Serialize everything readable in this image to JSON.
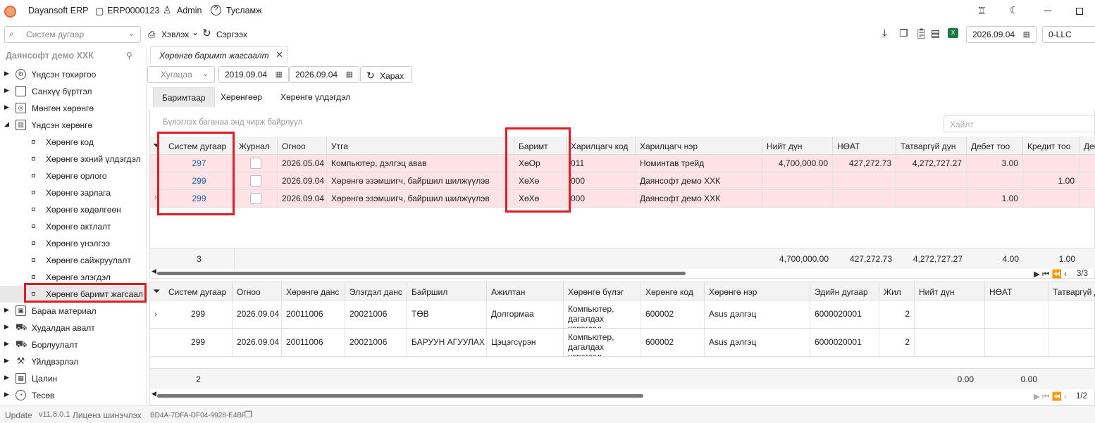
{
  "titlebar": {
    "app_name": "Dayansoft ERP",
    "doc_id": "ERP0000123",
    "user": "Admin",
    "help": "Тусламж"
  },
  "toolbar": {
    "system_number_placeholder": "Систем дугаар",
    "print_label": "Хэвлэх",
    "refresh_label": "Сэргээх",
    "date": "2026.09.04",
    "company_code": "0-LLC"
  },
  "sidebar": {
    "company": "Даянсофт демо ХХК",
    "items": [
      {
        "label": "Үндсэн тохиргоо",
        "icon": "gear-icon"
      },
      {
        "label": "Санхүү бүртгэл",
        "icon": "ledger-icon"
      },
      {
        "label": "Мөнгөн хөрөнгө",
        "icon": "money-icon"
      },
      {
        "label": "Үндсэн хөрөнгө",
        "icon": "building-icon"
      }
    ],
    "subitems": [
      "Хөрөнгө код",
      "Хөрөнгө эхний үлдэгдэл",
      "Хөрөнгө орлого",
      "Хөрөнгө зарлага",
      "Хөрөнгө хөдөлгөөн",
      "Хөрөнгө актлалт",
      "Хөрөнгө үнэлгээ",
      "Хөрөнгө сайжруулалт",
      "Хөрөнгө элэгдэл",
      "Хөрөнгө баримт жагсаал"
    ],
    "items_after": [
      {
        "label": "Бараа материал",
        "icon": "box-icon"
      },
      {
        "label": "Худалдан авалт",
        "icon": "cart-icon"
      },
      {
        "label": "Борлуулалт",
        "icon": "cart-icon"
      },
      {
        "label": "Үйлдвэрлэл",
        "icon": "factory-icon"
      },
      {
        "label": "Цалин",
        "icon": "calculator-icon"
      },
      {
        "label": "Тесөв",
        "icon": "pie-icon"
      }
    ]
  },
  "main": {
    "doc_tab": "Хөрөнгө баримт жагсаалт",
    "period_placeholder": "Хугацаа",
    "date_from": "2019.09.04",
    "date_to": "2026.09.04",
    "view_button": "Харах",
    "subtabs": [
      "Баримтаар",
      "Хөрөнгөөр",
      "Хөрөнгө үлдэгдэл"
    ],
    "group_hint": "Бүлэглэх баганаа энд чирж байрлуул",
    "search_placeholder": "Хайлт",
    "top_grid": {
      "columns": [
        "Систем дугаар",
        "Журнал",
        "Огноо",
        "Утга",
        "Баримт",
        "Харилцагч код",
        "Харилцагч нэр",
        "Нийт дүн",
        "НӨАТ",
        "Татваргүй дүн",
        "Дебет тоо",
        "Кредит тоо",
        "Деб"
      ],
      "rows": [
        [
          "297",
          "",
          "2026.05.04",
          "Компьютер, дэлгэц авав",
          "ХөОр",
          "011",
          "Номинтав трейд",
          "4,700,000.00",
          "427,272.73",
          "4,272,727.27",
          "3.00",
          "",
          ""
        ],
        [
          "299",
          "",
          "2026.09.04",
          "Хөрөнгө эзэмшигч, байршил шилжүүлэв",
          "ХөХө",
          "000",
          "Даянсофт демо ХХК",
          "",
          "",
          "",
          "",
          "1.00",
          ""
        ],
        [
          "299",
          "",
          "2026.09.04",
          "Хөрөнгө эзэмшигч, байршил шилжүүлэв",
          "ХөХө",
          "000",
          "Даянсофт демо ХХК",
          "",
          "",
          "",
          "1.00",
          "",
          ""
        ]
      ],
      "footer": {
        "count": "3",
        "total": "4,700,000.00",
        "vat": "427,272.73",
        "net": "4,272,727.27",
        "debit": "4.00",
        "credit": "1.00"
      },
      "pager": "3/3"
    },
    "bottom_grid": {
      "columns": [
        "Систем дугаар",
        "Огноо",
        "Хөрөнгө данс",
        "Элэгдэл данс",
        "Байршил",
        "Ажилтан",
        "Хөрөнгө бүлэг",
        "Хөрөнгө код",
        "Хөрөнгө нэр",
        "Эдийн дугаар",
        "Жил",
        "Нийт дүн",
        "НӨАТ",
        "Татваргүй д"
      ],
      "rows": [
        [
          "299",
          "2026.09.04",
          "20011006",
          "20021006",
          "ТӨВ",
          "Долгормаа",
          "Компьютер, дагалдах хэрэгсэл",
          "600002",
          "Asus дэлгэц",
          "6000020001",
          "2",
          "",
          "",
          ""
        ],
        [
          "299",
          "2026.09.04",
          "20011006",
          "20021006",
          "БАРУУН АГУУЛАХ",
          "Цэцэгсүрэн",
          "Компьютер, дагалдах хэрэгсэл",
          "600002",
          "Asus дэлгэц",
          "6000020001",
          "2",
          "",
          "",
          ""
        ]
      ],
      "footer": {
        "count": "2",
        "vat": "0.00",
        "net": "0.00"
      },
      "pager": "1/2"
    }
  },
  "statusbar": {
    "update": "Update",
    "version": "v11.8.0.1",
    "license": "Лиценз шинэчлэх",
    "license_key": "BD4A-7DFA-DF04-9928-E4BF"
  },
  "colors": {
    "highlight_box": "#e01b24",
    "row_highlight": "#fde3e6",
    "link": "#1a5fb4"
  }
}
